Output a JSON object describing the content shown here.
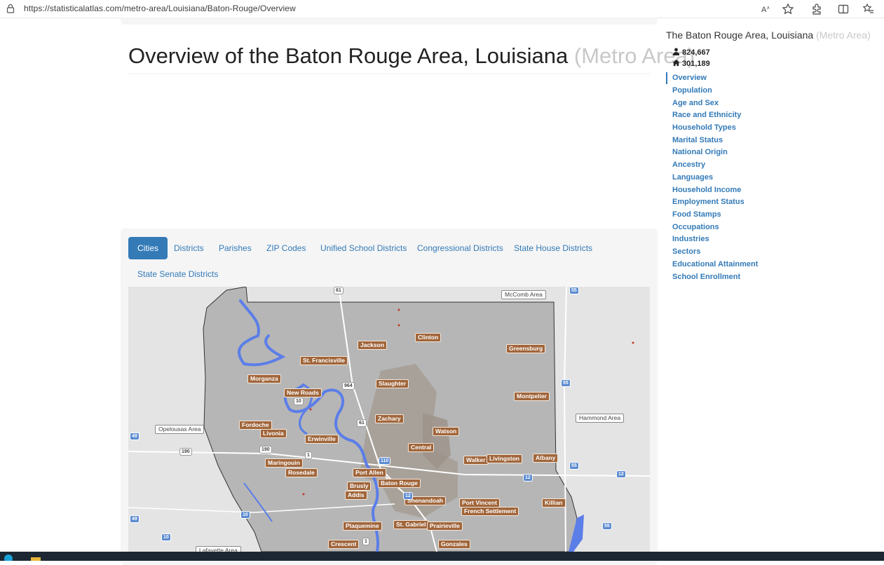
{
  "browser": {
    "url": "https://statisticalatlas.com/metro-area/Louisiana/Baton-Rouge/Overview",
    "icons": [
      "lock-icon",
      "read-aloud-icon",
      "favorite-star-icon",
      "extensions-icon",
      "split-screen-icon",
      "favorites-icon"
    ]
  },
  "page": {
    "title": "Overview of the Baton Rouge Area, Louisiana",
    "title_suffix": "(Metro Area)"
  },
  "tabs": [
    {
      "label": "Cities",
      "active": true
    },
    {
      "label": "Districts"
    },
    {
      "label": "Parishes"
    },
    {
      "label": "ZIP Codes"
    },
    {
      "label": "Unified School Districts"
    },
    {
      "label": "Congressional Districts"
    },
    {
      "label": "State House Districts"
    },
    {
      "label": "State Senate Districts"
    }
  ],
  "map": {
    "cities": [
      "Clinton",
      "Jackson",
      "Greensburg",
      "St. Francisville",
      "Morganza",
      "Slaughter",
      "New Roads",
      "Montpelier",
      "Zachary",
      "Fordoche",
      "Watson",
      "Livonia",
      "Erwinville",
      "Central",
      "Walker",
      "Livingston",
      "Albany",
      "Maringouin",
      "Rosedale",
      "Port Allen",
      "Baton Rouge",
      "Brusly",
      "Addis",
      "Shenandoah",
      "Port Vincent",
      "Killian",
      "French Settlement",
      "Plaquemine",
      "St. Gabriel",
      "Prairieville",
      "Crescent",
      "Gonzales"
    ],
    "areas": [
      "McComb Area",
      "Hammond Area",
      "Opelousas Area",
      "Lafayette Area"
    ],
    "highways": [
      "61",
      "964",
      "10",
      "61",
      "190",
      "1",
      "110",
      "12",
      "12",
      "10",
      "10",
      "1",
      "190",
      "49",
      "49",
      "55",
      "55",
      "55",
      "55",
      "12"
    ]
  },
  "sidebar": {
    "title": "The Baton Rouge Area, Louisiana",
    "title_suffix": "(Metro Area)",
    "population": "824,667",
    "households": "301,189",
    "nav": [
      "Overview",
      "Population",
      "Age and Sex",
      "Race and Ethnicity",
      "Household Types",
      "Marital Status",
      "National Origin",
      "Ancestry",
      "Languages",
      "Household Income",
      "Employment Status",
      "Food Stamps",
      "Occupations",
      "Industries",
      "Sectors",
      "Educational Attainment",
      "School Enrollment"
    ],
    "nav_active": "Overview"
  },
  "colors": {
    "link": "#337ab7",
    "city_label": "#a0653a",
    "river": "#5b7ee8"
  }
}
